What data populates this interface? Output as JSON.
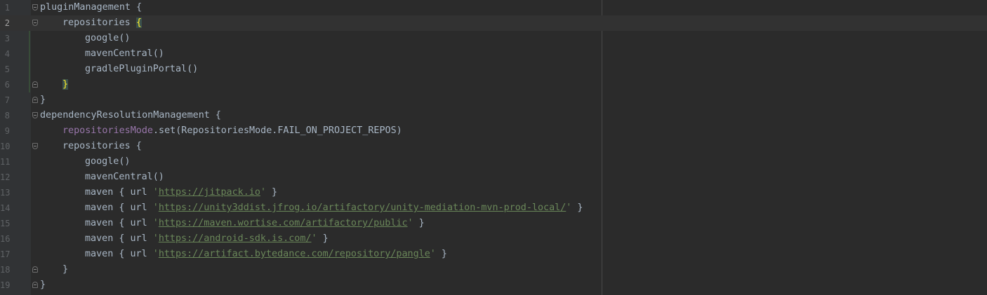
{
  "editor": {
    "current_line": 2,
    "lines": [
      {
        "num": "1",
        "indent": 0,
        "fold": "open",
        "parts": [
          {
            "t": "pluginManagement {",
            "c": "plain"
          }
        ]
      },
      {
        "num": "2",
        "indent": 1,
        "fold": "open",
        "parts": [
          {
            "t": "repositories ",
            "c": "plain"
          },
          {
            "t": "{",
            "c": "brace-hl"
          }
        ]
      },
      {
        "num": "3",
        "indent": 2,
        "fold": "",
        "parts": [
          {
            "t": "google()",
            "c": "plain"
          }
        ]
      },
      {
        "num": "4",
        "indent": 2,
        "fold": "",
        "parts": [
          {
            "t": "mavenCentral()",
            "c": "plain"
          }
        ]
      },
      {
        "num": "5",
        "indent": 2,
        "fold": "",
        "parts": [
          {
            "t": "gradlePluginPortal()",
            "c": "plain"
          }
        ]
      },
      {
        "num": "6",
        "indent": 1,
        "fold": "close",
        "parts": [
          {
            "t": "}",
            "c": "brace-hl"
          }
        ]
      },
      {
        "num": "7",
        "indent": 0,
        "fold": "close",
        "parts": [
          {
            "t": "}",
            "c": "plain"
          }
        ]
      },
      {
        "num": "8",
        "indent": 0,
        "fold": "open",
        "parts": [
          {
            "t": "dependencyResolutionManagement {",
            "c": "plain"
          }
        ]
      },
      {
        "num": "9",
        "indent": 1,
        "fold": "",
        "parts": [
          {
            "t": "repositoriesMode",
            "c": "prop"
          },
          {
            "t": ".set(RepositoriesMode.FAIL_ON_PROJECT_REPOS)",
            "c": "plain"
          }
        ]
      },
      {
        "num": "10",
        "indent": 1,
        "fold": "open",
        "parts": [
          {
            "t": "repositories {",
            "c": "plain"
          }
        ]
      },
      {
        "num": "11",
        "indent": 2,
        "fold": "",
        "parts": [
          {
            "t": "google()",
            "c": "plain"
          }
        ]
      },
      {
        "num": "12",
        "indent": 2,
        "fold": "",
        "parts": [
          {
            "t": "mavenCentral()",
            "c": "plain"
          }
        ]
      },
      {
        "num": "13",
        "indent": 2,
        "fold": "",
        "parts": [
          {
            "t": "maven { url ",
            "c": "plain"
          },
          {
            "t": "'",
            "c": "str"
          },
          {
            "t": "https://jitpack.io",
            "c": "url"
          },
          {
            "t": "'",
            "c": "str"
          },
          {
            "t": " }",
            "c": "plain"
          }
        ]
      },
      {
        "num": "14",
        "indent": 2,
        "fold": "",
        "parts": [
          {
            "t": "maven { url ",
            "c": "plain"
          },
          {
            "t": "'",
            "c": "str"
          },
          {
            "t": "https://unity3ddist.jfrog.io/artifactory/unity-mediation-mvn-prod-local/",
            "c": "url"
          },
          {
            "t": "'",
            "c": "str"
          },
          {
            "t": " }",
            "c": "plain"
          }
        ]
      },
      {
        "num": "15",
        "indent": 2,
        "fold": "",
        "parts": [
          {
            "t": "maven { url ",
            "c": "plain"
          },
          {
            "t": "'",
            "c": "str"
          },
          {
            "t": "https://maven.wortise.com/artifactory/public",
            "c": "url"
          },
          {
            "t": "'",
            "c": "str"
          },
          {
            "t": " }",
            "c": "plain"
          }
        ]
      },
      {
        "num": "16",
        "indent": 2,
        "fold": "",
        "parts": [
          {
            "t": "maven { url ",
            "c": "plain"
          },
          {
            "t": "'",
            "c": "str"
          },
          {
            "t": "https://android-sdk.is.com/",
            "c": "url"
          },
          {
            "t": "'",
            "c": "str"
          },
          {
            "t": " }",
            "c": "plain"
          }
        ]
      },
      {
        "num": "17",
        "indent": 2,
        "fold": "",
        "parts": [
          {
            "t": "maven { url ",
            "c": "plain"
          },
          {
            "t": "'",
            "c": "str"
          },
          {
            "t": "https://artifact.bytedance.com/repository/pangle",
            "c": "url"
          },
          {
            "t": "'",
            "c": "str"
          },
          {
            "t": " }",
            "c": "plain"
          }
        ]
      },
      {
        "num": "18",
        "indent": 1,
        "fold": "close",
        "parts": [
          {
            "t": "}",
            "c": "plain"
          }
        ]
      },
      {
        "num": "19",
        "indent": 0,
        "fold": "close",
        "parts": [
          {
            "t": "}",
            "c": "plain"
          }
        ]
      }
    ]
  },
  "colors": {
    "background": "#2b2b2b",
    "gutter": "#313335",
    "plain_text": "#a9b7c6",
    "property": "#9876aa",
    "string": "#6a8759",
    "brace_highlight": "#ffef28",
    "line_number": "#606366"
  }
}
